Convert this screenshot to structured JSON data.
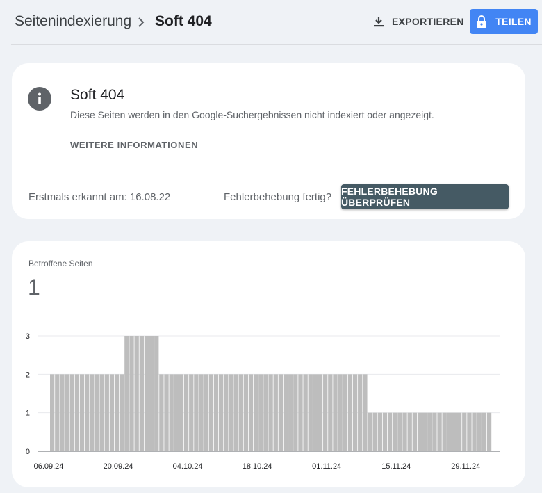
{
  "header": {
    "breadcrumb_root": "Seitenindexierung",
    "breadcrumb_current": "Soft 404",
    "export_label": "EXPORTIEREN",
    "share_label": "TEILEN",
    "accent_color": "#4285f4"
  },
  "issue": {
    "title": "Soft 404",
    "description": "Diese Seiten werden in den Google-Suchergebnissen nicht indexiert oder angezeigt.",
    "more_info_label": "WEITERE INFORMATIONEN",
    "first_detected": "Erstmals erkannt am: 16.08.22",
    "fix_question": "Fehlerbehebung fertig?",
    "validate_label": "FEHLERBEHEBUNG ÜBERPRÜFEN",
    "validate_color": "#455a64"
  },
  "metric": {
    "label": "Betroffene Seiten",
    "value": "1"
  },
  "chart_data": {
    "type": "bar",
    "bar_color": "#bdbdbd",
    "ylim": [
      0,
      3
    ],
    "y_ticks": [
      "0",
      "1",
      "2",
      "3"
    ],
    "x_tick_labels": [
      "06.09.24",
      "20.09.24",
      "04.10.24",
      "18.10.24",
      "01.11.24",
      "15.11.24",
      "29.11.24"
    ],
    "series": [
      {
        "values": [
          2,
          2,
          2,
          2,
          2,
          2,
          2,
          2,
          2,
          2,
          2,
          2,
          2,
          2,
          2,
          3,
          3,
          3,
          3,
          3,
          3,
          3,
          2,
          2,
          2,
          2,
          2,
          2,
          2,
          2,
          2,
          2,
          2,
          2,
          2,
          2,
          2,
          2,
          2,
          2,
          2,
          2,
          2,
          2,
          2,
          2,
          2,
          2,
          2,
          2,
          2,
          2,
          2,
          2,
          2,
          2,
          2,
          2,
          2,
          2,
          2,
          2,
          2,
          2,
          1,
          1,
          1,
          1,
          1,
          1,
          1,
          1,
          1,
          1,
          1,
          1,
          1,
          1,
          1,
          1,
          1,
          1,
          1,
          1,
          1,
          1,
          1,
          1,
          1
        ]
      }
    ]
  }
}
